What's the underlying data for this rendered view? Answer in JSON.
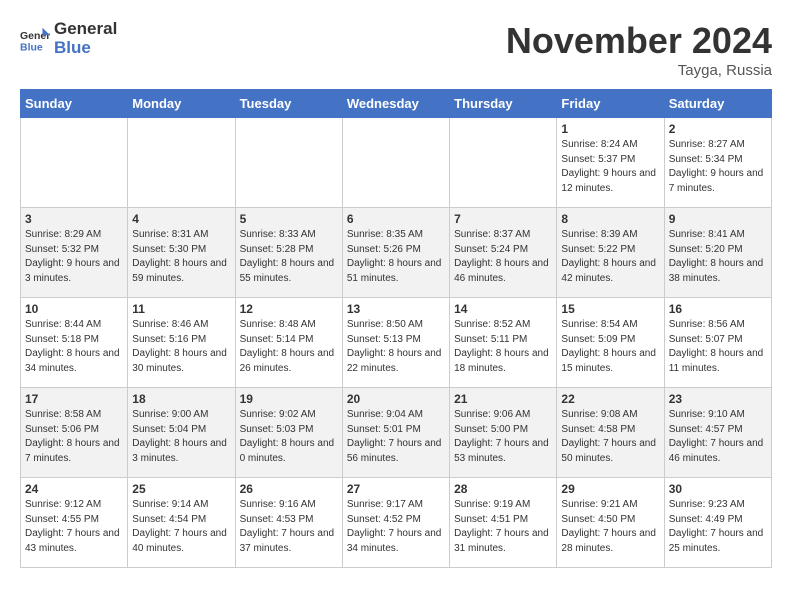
{
  "header": {
    "logo_general": "General",
    "logo_blue": "Blue",
    "month_title": "November 2024",
    "location": "Tayga, Russia"
  },
  "columns": [
    "Sunday",
    "Monday",
    "Tuesday",
    "Wednesday",
    "Thursday",
    "Friday",
    "Saturday"
  ],
  "weeks": [
    [
      {
        "num": "",
        "info": ""
      },
      {
        "num": "",
        "info": ""
      },
      {
        "num": "",
        "info": ""
      },
      {
        "num": "",
        "info": ""
      },
      {
        "num": "",
        "info": ""
      },
      {
        "num": "1",
        "info": "Sunrise: 8:24 AM\nSunset: 5:37 PM\nDaylight: 9 hours and 12 minutes."
      },
      {
        "num": "2",
        "info": "Sunrise: 8:27 AM\nSunset: 5:34 PM\nDaylight: 9 hours and 7 minutes."
      }
    ],
    [
      {
        "num": "3",
        "info": "Sunrise: 8:29 AM\nSunset: 5:32 PM\nDaylight: 9 hours and 3 minutes."
      },
      {
        "num": "4",
        "info": "Sunrise: 8:31 AM\nSunset: 5:30 PM\nDaylight: 8 hours and 59 minutes."
      },
      {
        "num": "5",
        "info": "Sunrise: 8:33 AM\nSunset: 5:28 PM\nDaylight: 8 hours and 55 minutes."
      },
      {
        "num": "6",
        "info": "Sunrise: 8:35 AM\nSunset: 5:26 PM\nDaylight: 8 hours and 51 minutes."
      },
      {
        "num": "7",
        "info": "Sunrise: 8:37 AM\nSunset: 5:24 PM\nDaylight: 8 hours and 46 minutes."
      },
      {
        "num": "8",
        "info": "Sunrise: 8:39 AM\nSunset: 5:22 PM\nDaylight: 8 hours and 42 minutes."
      },
      {
        "num": "9",
        "info": "Sunrise: 8:41 AM\nSunset: 5:20 PM\nDaylight: 8 hours and 38 minutes."
      }
    ],
    [
      {
        "num": "10",
        "info": "Sunrise: 8:44 AM\nSunset: 5:18 PM\nDaylight: 8 hours and 34 minutes."
      },
      {
        "num": "11",
        "info": "Sunrise: 8:46 AM\nSunset: 5:16 PM\nDaylight: 8 hours and 30 minutes."
      },
      {
        "num": "12",
        "info": "Sunrise: 8:48 AM\nSunset: 5:14 PM\nDaylight: 8 hours and 26 minutes."
      },
      {
        "num": "13",
        "info": "Sunrise: 8:50 AM\nSunset: 5:13 PM\nDaylight: 8 hours and 22 minutes."
      },
      {
        "num": "14",
        "info": "Sunrise: 8:52 AM\nSunset: 5:11 PM\nDaylight: 8 hours and 18 minutes."
      },
      {
        "num": "15",
        "info": "Sunrise: 8:54 AM\nSunset: 5:09 PM\nDaylight: 8 hours and 15 minutes."
      },
      {
        "num": "16",
        "info": "Sunrise: 8:56 AM\nSunset: 5:07 PM\nDaylight: 8 hours and 11 minutes."
      }
    ],
    [
      {
        "num": "17",
        "info": "Sunrise: 8:58 AM\nSunset: 5:06 PM\nDaylight: 8 hours and 7 minutes."
      },
      {
        "num": "18",
        "info": "Sunrise: 9:00 AM\nSunset: 5:04 PM\nDaylight: 8 hours and 3 minutes."
      },
      {
        "num": "19",
        "info": "Sunrise: 9:02 AM\nSunset: 5:03 PM\nDaylight: 8 hours and 0 minutes."
      },
      {
        "num": "20",
        "info": "Sunrise: 9:04 AM\nSunset: 5:01 PM\nDaylight: 7 hours and 56 minutes."
      },
      {
        "num": "21",
        "info": "Sunrise: 9:06 AM\nSunset: 5:00 PM\nDaylight: 7 hours and 53 minutes."
      },
      {
        "num": "22",
        "info": "Sunrise: 9:08 AM\nSunset: 4:58 PM\nDaylight: 7 hours and 50 minutes."
      },
      {
        "num": "23",
        "info": "Sunrise: 9:10 AM\nSunset: 4:57 PM\nDaylight: 7 hours and 46 minutes."
      }
    ],
    [
      {
        "num": "24",
        "info": "Sunrise: 9:12 AM\nSunset: 4:55 PM\nDaylight: 7 hours and 43 minutes."
      },
      {
        "num": "25",
        "info": "Sunrise: 9:14 AM\nSunset: 4:54 PM\nDaylight: 7 hours and 40 minutes."
      },
      {
        "num": "26",
        "info": "Sunrise: 9:16 AM\nSunset: 4:53 PM\nDaylight: 7 hours and 37 minutes."
      },
      {
        "num": "27",
        "info": "Sunrise: 9:17 AM\nSunset: 4:52 PM\nDaylight: 7 hours and 34 minutes."
      },
      {
        "num": "28",
        "info": "Sunrise: 9:19 AM\nSunset: 4:51 PM\nDaylight: 7 hours and 31 minutes."
      },
      {
        "num": "29",
        "info": "Sunrise: 9:21 AM\nSunset: 4:50 PM\nDaylight: 7 hours and 28 minutes."
      },
      {
        "num": "30",
        "info": "Sunrise: 9:23 AM\nSunset: 4:49 PM\nDaylight: 7 hours and 25 minutes."
      }
    ]
  ]
}
